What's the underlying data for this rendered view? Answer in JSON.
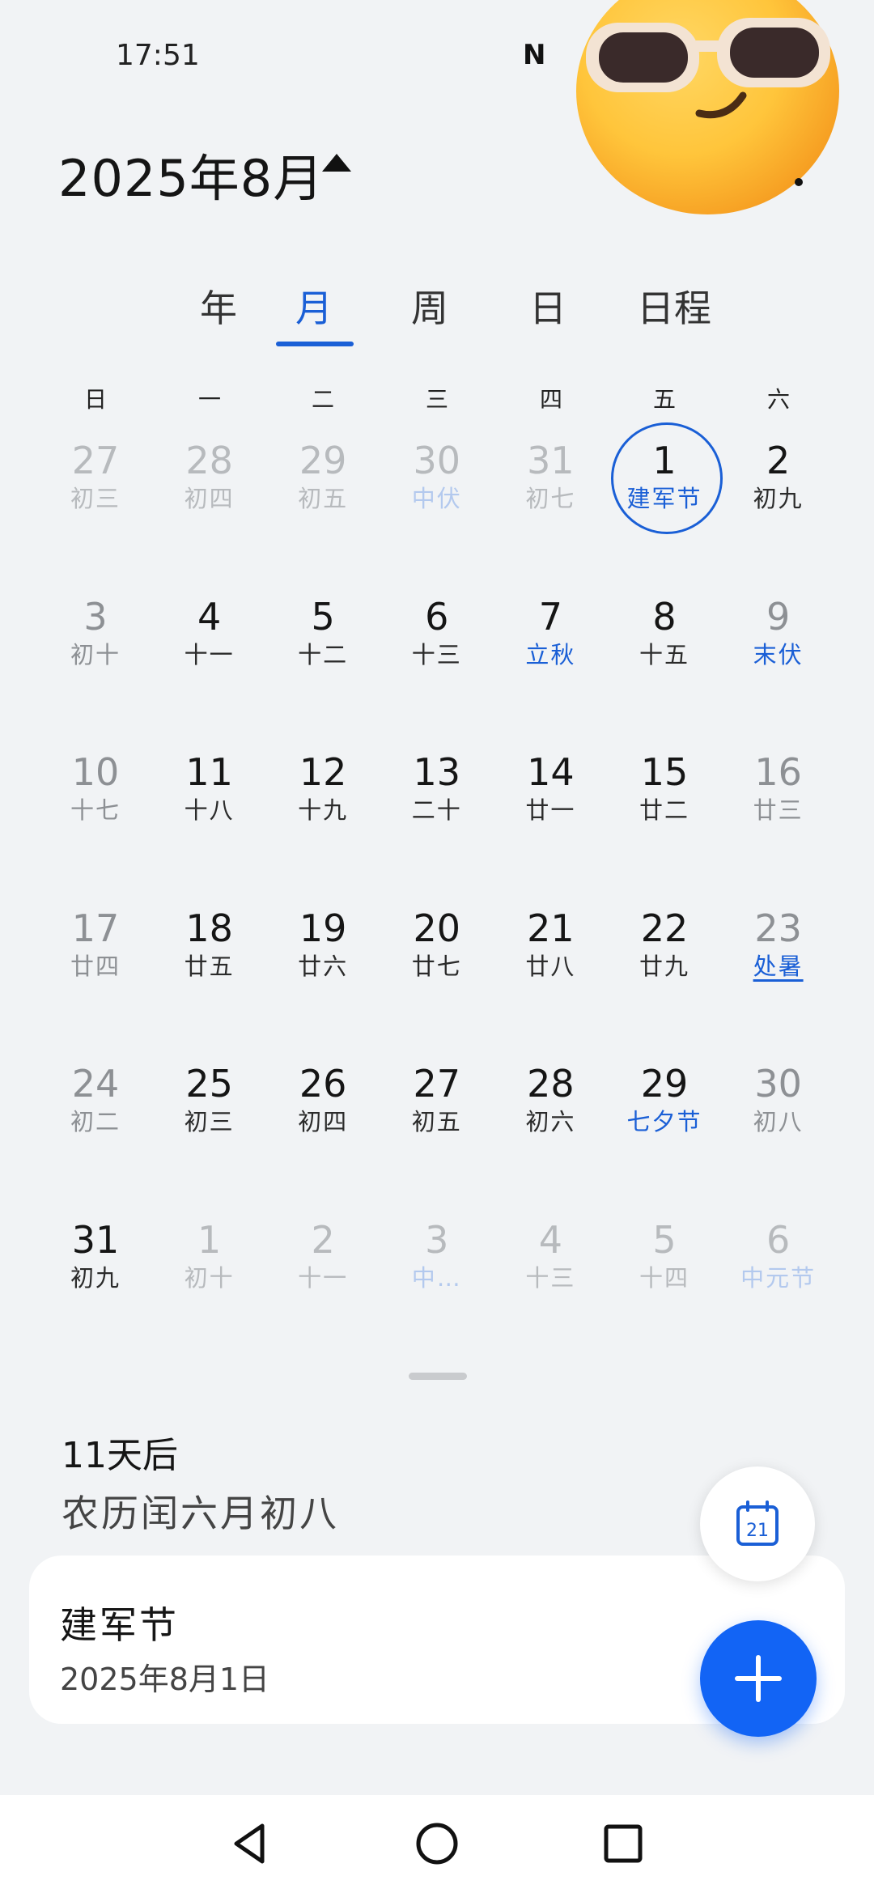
{
  "status_bar": {
    "time": "17:51",
    "nfc_icon": "N"
  },
  "header": {
    "title": "2025年8月"
  },
  "tabs": [
    {
      "label": "年"
    },
    {
      "label": "月",
      "active": true
    },
    {
      "label": "周"
    },
    {
      "label": "日"
    },
    {
      "label": "日程"
    }
  ],
  "weekdays": [
    "日",
    "一",
    "二",
    "三",
    "四",
    "五",
    "六"
  ],
  "calendar": {
    "weeks": [
      [
        {
          "day": "27",
          "lunar": "初三",
          "state": "dim"
        },
        {
          "day": "28",
          "lunar": "初四",
          "state": "dim"
        },
        {
          "day": "29",
          "lunar": "初五",
          "state": "dim"
        },
        {
          "day": "30",
          "lunar": "中伏",
          "state": "dim",
          "festival": true
        },
        {
          "day": "31",
          "lunar": "初七",
          "state": "dim"
        },
        {
          "day": "1",
          "lunar": "建军节",
          "festival": true,
          "today": true
        },
        {
          "day": "2",
          "lunar": "初九"
        }
      ],
      [
        {
          "day": "3",
          "lunar": "初十",
          "state": "weekend"
        },
        {
          "day": "4",
          "lunar": "十一"
        },
        {
          "day": "5",
          "lunar": "十二"
        },
        {
          "day": "6",
          "lunar": "十三"
        },
        {
          "day": "7",
          "lunar": "立秋",
          "festival": true
        },
        {
          "day": "8",
          "lunar": "十五"
        },
        {
          "day": "9",
          "lunar": "末伏",
          "state": "weekend",
          "festival": true
        }
      ],
      [
        {
          "day": "10",
          "lunar": "十七",
          "state": "weekend"
        },
        {
          "day": "11",
          "lunar": "十八"
        },
        {
          "day": "12",
          "lunar": "十九"
        },
        {
          "day": "13",
          "lunar": "二十"
        },
        {
          "day": "14",
          "lunar": "廿一"
        },
        {
          "day": "15",
          "lunar": "廿二"
        },
        {
          "day": "16",
          "lunar": "廿三",
          "state": "weekend"
        }
      ],
      [
        {
          "day": "17",
          "lunar": "廿四",
          "state": "weekend"
        },
        {
          "day": "18",
          "lunar": "廿五"
        },
        {
          "day": "19",
          "lunar": "廿六"
        },
        {
          "day": "20",
          "lunar": "廿七"
        },
        {
          "day": "21",
          "lunar": "廿八"
        },
        {
          "day": "22",
          "lunar": "廿九"
        },
        {
          "day": "23",
          "lunar": "处暑",
          "state": "weekend",
          "festival": true,
          "underline": true
        }
      ],
      [
        {
          "day": "24",
          "lunar": "初二",
          "state": "weekend"
        },
        {
          "day": "25",
          "lunar": "初三"
        },
        {
          "day": "26",
          "lunar": "初四"
        },
        {
          "day": "27",
          "lunar": "初五"
        },
        {
          "day": "28",
          "lunar": "初六"
        },
        {
          "day": "29",
          "lunar": "七夕节",
          "festival": true
        },
        {
          "day": "30",
          "lunar": "初八",
          "state": "weekend"
        }
      ],
      [
        {
          "day": "31",
          "lunar": "初九"
        },
        {
          "day": "1",
          "lunar": "初十",
          "state": "dim"
        },
        {
          "day": "2",
          "lunar": "十一",
          "state": "dim"
        },
        {
          "day": "3",
          "lunar": "中…",
          "state": "dim",
          "festival": true
        },
        {
          "day": "4",
          "lunar": "十三",
          "state": "dim"
        },
        {
          "day": "5",
          "lunar": "十四",
          "state": "dim"
        },
        {
          "day": "6",
          "lunar": "中元节",
          "state": "dim",
          "festival": true
        }
      ]
    ]
  },
  "detail": {
    "days_until": "11天后",
    "lunar_date": "农历闰六月初八"
  },
  "event": {
    "title": "建军节",
    "date": "2025年8月1日"
  },
  "fab_today": {
    "icon": "calendar-today-icon",
    "day": "21"
  },
  "fab_add": {
    "icon": "plus-icon"
  },
  "colors": {
    "accent": "#1a5fd6",
    "fab": "#1264f5",
    "background": "#f1f3f5"
  }
}
